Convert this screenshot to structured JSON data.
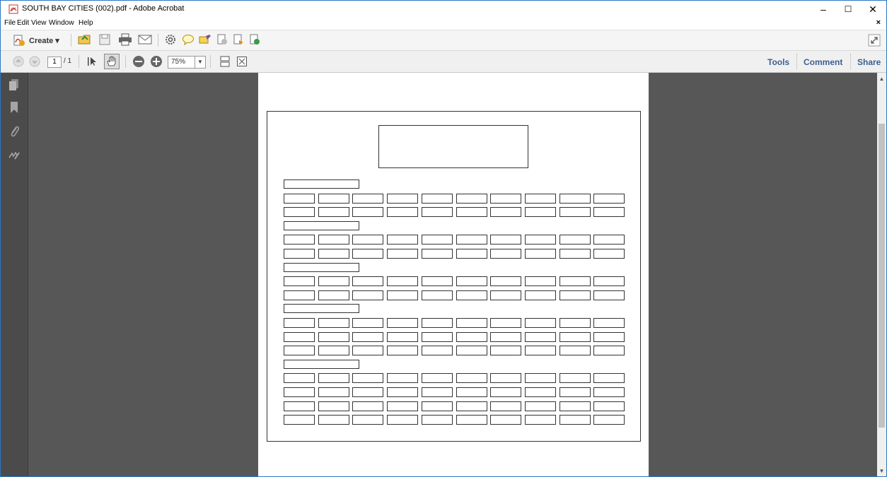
{
  "window": {
    "title": "SOUTH BAY CITIES (002).pdf - Adobe Acrobat",
    "controls": {
      "minimize": "–",
      "maximize": "☐",
      "close": "✕"
    }
  },
  "menu": {
    "items": [
      "File",
      "Edit",
      "View",
      "Window",
      "Help"
    ],
    "close_doc": "×"
  },
  "toolbar": {
    "create_label": "Create",
    "icons": [
      "open-icon",
      "save-icon",
      "print-icon",
      "email-icon",
      "settings-icon",
      "comment-icon",
      "highlight-icon",
      "export-icon",
      "combine-icon",
      "share-file-icon"
    ]
  },
  "navbar": {
    "page_current": "1",
    "page_total": "/ 1",
    "zoom": "75%",
    "tools_label": "Tools",
    "comment_label": "Comment",
    "share_label": "Share"
  },
  "colors": {
    "title_border": "#2b79c2",
    "doc_background": "#575757",
    "rail_background": "#4b4b4b",
    "link_blue": "#3c5f8f"
  },
  "document": {
    "sections": [
      {
        "rows": 2
      },
      {
        "rows": 2
      },
      {
        "rows": 2
      },
      {
        "rows": 3
      },
      {
        "rows": 4
      }
    ],
    "columns": 10
  }
}
